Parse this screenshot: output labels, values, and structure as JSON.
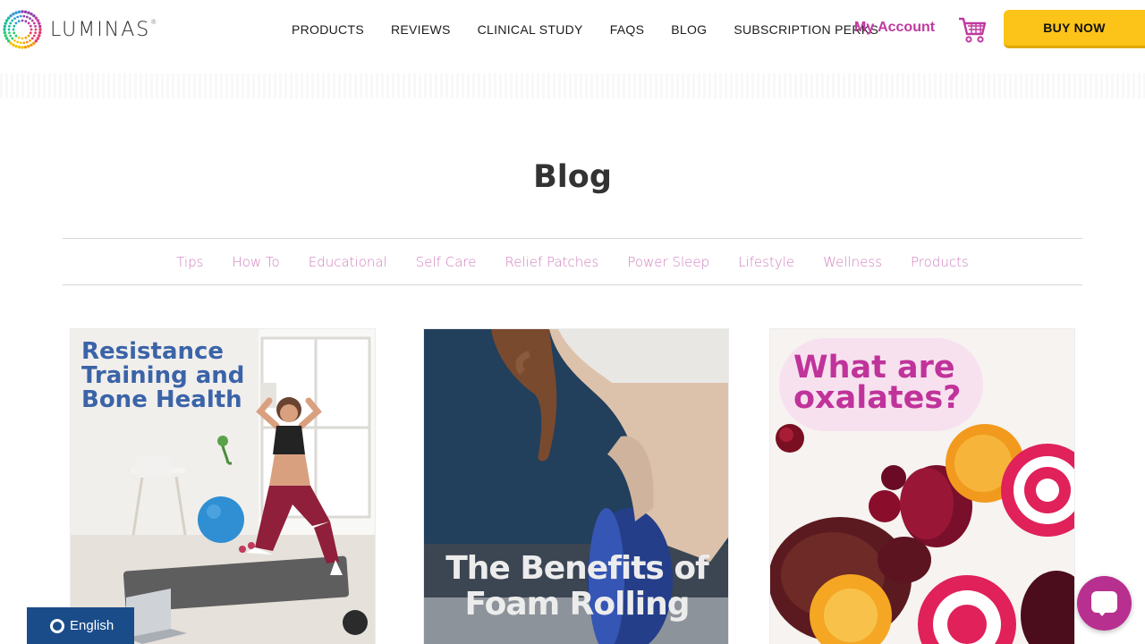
{
  "header": {
    "logo_text": "LUMINAS",
    "logo_registered": "®",
    "nav": [
      {
        "label": "PRODUCTS"
      },
      {
        "label": "REVIEWS"
      },
      {
        "label": "CLINICAL STUDY"
      },
      {
        "label": "FAQS"
      },
      {
        "label": "BLOG"
      },
      {
        "label": "SUBSCRIPTION PERKS"
      }
    ],
    "account_label": "My Account",
    "cart_icon": "shopping-cart-icon",
    "buy_label": "BUY NOW"
  },
  "page": {
    "title": "Blog"
  },
  "categories": [
    {
      "label": "Tips"
    },
    {
      "label": "How To"
    },
    {
      "label": "Educational"
    },
    {
      "label": "Self Care"
    },
    {
      "label": "Relief Patches"
    },
    {
      "label": "Power Sleep"
    },
    {
      "label": "Lifestyle"
    },
    {
      "label": "Wellness"
    },
    {
      "label": "Products"
    }
  ],
  "posts": [
    {
      "image_title": "Resistance Training and Bone Health"
    },
    {
      "image_title": "The Benefits of Foam Rolling"
    },
    {
      "image_title": "What are oxalates?"
    }
  ],
  "language": {
    "label": "English",
    "icon": "globe-icon"
  },
  "chat": {
    "icon": "chat-icon"
  },
  "colors": {
    "accent_pink": "#c0399f",
    "category_pink": "#d27fbf",
    "buy_yellow": "#fcc419",
    "lang_blue": "#1a4c8a",
    "card1_title_blue": "#3b64a8"
  }
}
